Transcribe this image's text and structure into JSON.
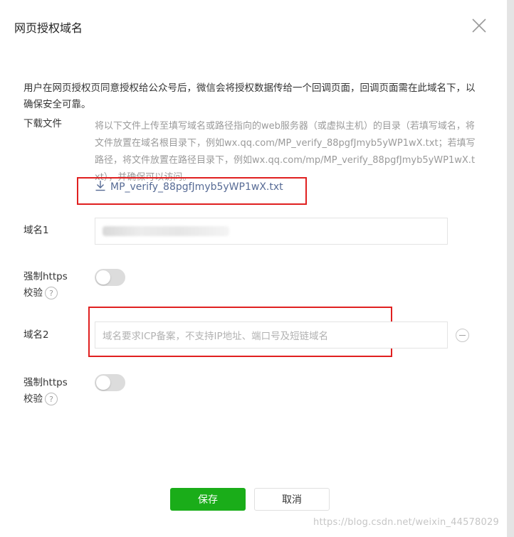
{
  "dialog": {
    "title": "网页授权域名",
    "close_icon": "close-icon"
  },
  "description": "用户在网页授权页同意授权给公众号后，微信会将授权数据传给一个回调页面，回调页面需在此域名下，以确保安全可靠。",
  "download": {
    "label": "下载文件",
    "hint": "将以下文件上传至填写域名或路径指向的web服务器（或虚拟主机）的目录（若填写域名，将文件放置在域名根目录下，例如wx.qq.com/MP_verify_88pgfJmyb5yWP1wX.txt；若填写路径，将文件放置在路径目录下，例如wx.qq.com/mp/MP_verify_88pgfJmyb5yWP1wX.txt），并确保可以访问。",
    "file_name": "MP_verify_88pgfJmyb5yWP1wX.txt",
    "icon": "download-icon"
  },
  "domain1": {
    "label": "域名1",
    "value_obscured": true
  },
  "https1": {
    "label_line1": "强制https",
    "label_line2": "校验",
    "help": "?",
    "enabled": false
  },
  "domain2": {
    "label": "域名2",
    "placeholder": "域名要求ICP备案，不支持IP地址、端口号及短链域名",
    "remove_icon": "minus-circle-icon"
  },
  "https2": {
    "label_line1": "强制https",
    "label_line2": "校验",
    "help": "?",
    "enabled": false
  },
  "buttons": {
    "save": "保存",
    "cancel": "取消"
  },
  "watermark": "https://blog.csdn.net/weixin_44578029",
  "colors": {
    "primary": "#1aad19",
    "link": "#576b95",
    "highlight_box": "#e02020"
  }
}
